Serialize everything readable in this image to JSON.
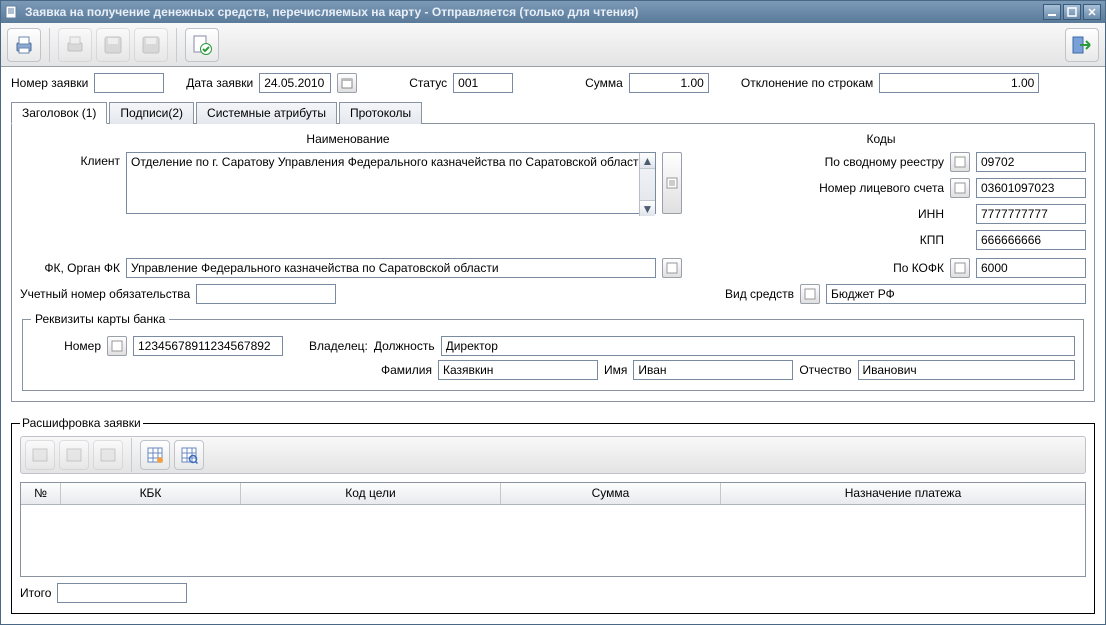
{
  "window": {
    "title": "Заявка на получение денежных средств, перечисляемых на карту - Отправляется (только для чтения)"
  },
  "toolbar": {
    "print": "print",
    "print2": "print-disabled",
    "save": "save-disabled",
    "save2": "save2-disabled",
    "approve": "approve",
    "exit": "exit"
  },
  "row1": {
    "num_label": "Номер заявки",
    "num_value": "",
    "date_label": "Дата заявки",
    "date_value": "24.05.2010",
    "status_label": "Статус",
    "status_value": "001",
    "sum_label": "Сумма",
    "sum_value": "1.00",
    "dev_label": "Отклонение по строкам",
    "dev_value": "1.00"
  },
  "tabs": [
    "Заголовок (1)",
    "Подписи(2)",
    "Системные атрибуты",
    "Протоколы"
  ],
  "headers": {
    "name": "Наименование",
    "codes": "Коды"
  },
  "client": {
    "label": "Клиент",
    "value": "Отделение по г. Саратову Управления Федерального казначейства по Саратовской области"
  },
  "codes": {
    "reestr_label": "По сводному реестру",
    "reestr_value": "09702",
    "lits_label": "Номер лицевого счета",
    "lits_value": "03601097023",
    "inn_label": "ИНН",
    "inn_value": "7777777777",
    "kpp_label": "КПП",
    "kpp_value": "666666666",
    "kofk_label": "По КОФК",
    "kofk_value": "6000"
  },
  "fk": {
    "label": "ФК, Орган ФК",
    "value": "Управление Федерального казначейства по Саратовской области"
  },
  "extra": {
    "uch_label": "Учетный номер обязательства",
    "uch_value": "",
    "vid_label": "Вид средств",
    "vid_value": "Бюджет РФ"
  },
  "card": {
    "legend": "Реквизиты карты банка",
    "num_label": "Номер",
    "num_value": "12345678911234567892",
    "owner_label": "Владелец:",
    "pos_label": "Должность",
    "pos_value": "Директор",
    "fam_label": "Фамилия",
    "fam_value": "Казявкин",
    "name_label": "Имя",
    "name_value": "Иван",
    "otch_label": "Отчество",
    "otch_value": "Иванович"
  },
  "detail": {
    "legend": "Расшифровка заявки",
    "columns": [
      "№",
      "КБК",
      "Код цели",
      "Сумма",
      "Назначение платежа"
    ],
    "total_label": "Итого",
    "total_value": ""
  }
}
